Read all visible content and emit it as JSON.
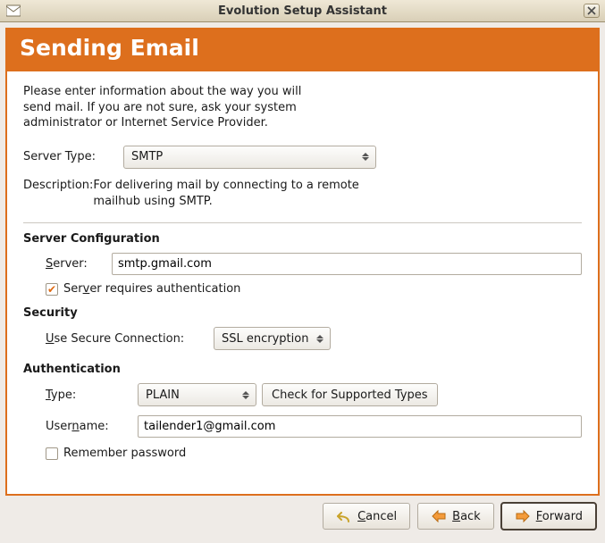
{
  "window": {
    "title": "Evolution Setup Assistant"
  },
  "header": {
    "title": "Sending Email"
  },
  "intro": "Please enter information about the way you will send mail. If you are not sure, ask your system administrator or Internet Service Provider.",
  "server_type": {
    "label": "Server Type:",
    "value": "SMTP"
  },
  "description": {
    "label": "Description:",
    "text": "For delivering mail by connecting to a remote mailhub using SMTP."
  },
  "sections": {
    "server_config": "Server Configuration",
    "security": "Security",
    "auth": "Authentication"
  },
  "server_field": {
    "label_pre": "S",
    "label_post": "erver:",
    "value": "smtp.gmail.com"
  },
  "requires_auth": {
    "label_pre": "Ser",
    "label_u": "v",
    "label_post": "er requires authentication",
    "checked": true
  },
  "secure_conn": {
    "label_pre": "U",
    "label_post": "se Secure Connection:",
    "value": "SSL encryption"
  },
  "auth_type": {
    "label_pre": "T",
    "label_post": "ype:",
    "value": "PLAIN",
    "button": "Check for Supported Types"
  },
  "username": {
    "label_pre": "User",
    "label_u": "n",
    "label_post": "ame:",
    "value": "tailender1@gmail.com"
  },
  "remember_pw": {
    "label": "Remember password",
    "checked": false
  },
  "buttons": {
    "cancel_pre": "C",
    "cancel_post": "ancel",
    "back_pre": "B",
    "back_post": "ack",
    "forward_pre": "F",
    "forward_post": "orward"
  }
}
